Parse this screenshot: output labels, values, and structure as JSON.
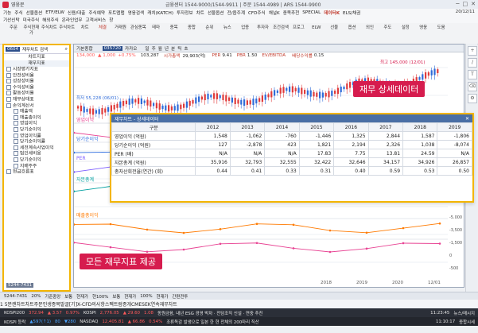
{
  "window": {
    "app_title": "영웅문",
    "center_info": "금융센터 1544-9000/1544-9911 | 주문 1544-4989 | ARS 1544-9900",
    "controls": [
      "─",
      "□",
      "✕"
    ]
  },
  "menu": {
    "items": [
      "기능",
      "주식",
      "선물옵션",
      "ETF/ELW",
      "신용/대출",
      "주식예약",
      "포트맵맵",
      "영웅검색",
      "캐치(KATCH)",
      "투자정보",
      "차트",
      "선물옵션",
      "전/옵주계",
      "CFD주식",
      "채널K",
      "종목추천",
      "SPECIAL",
      "데이터K",
      "ELS/채권"
    ],
    "highlight_index": 17,
    "items2": [
      "기산신탁",
      "미국주식",
      "해외주식",
      "온라인업무",
      "고객서비스",
      "창"
    ],
    "timestamp": "20/12/11",
    "time": "10:11:17"
  },
  "toolbar": {
    "buttons": [
      "주문",
      "주식현재가",
      "주식차트",
      "주식차트",
      "차트",
      "체결",
      "거래원",
      "관심종목",
      "테마",
      "종목",
      "종합",
      "순위",
      "뉴스",
      "업종",
      "투자자",
      "조건검색",
      "프로그",
      "ELW",
      "선물",
      "옵션",
      "외인",
      "주도",
      "설정",
      "영웅",
      "도움"
    ],
    "highlight_index": 5
  },
  "left_panel": {
    "code": "0604",
    "search_label": "재무차트 검색",
    "title": "차트지표",
    "section": "재무지표",
    "items": [
      "시장평가지표",
      "안전성비율",
      "성장성비율",
      "수익성비율",
      "활동성비율",
      "재무상태표",
      "손익계산서",
      "매출액",
      "매출총이익",
      "영업이익",
      "당기순이익",
      "영업이익률",
      "당기순이익률",
      "세전계속사업이익",
      "법인세비용",
      "당기순이익",
      "지배주주"
    ],
    "footer_items": [
      "현금흐름표"
    ],
    "bottom_code": "5244-7431"
  },
  "chart": {
    "tab_label": "기본종합",
    "code_label": "035720",
    "name_label": "카카오",
    "controls": [
      "일",
      "주",
      "월",
      "년",
      "분",
      "틱",
      "초"
    ],
    "quote": {
      "price": "134,000",
      "change": "▲ 1,000",
      "change_pct": "+0.75%",
      "volume": "103,287",
      "value_label": "시가총액",
      "value": "29,903(억)",
      "per_label": "PER",
      "per": "9.41",
      "pbr_label": "PBR",
      "pbr": "1.50",
      "ev_label": "EV/EBITDA",
      "div_label": "배당수익률",
      "div": "0.15"
    },
    "high_label": "최고 145,000 (12/01)",
    "low_label": "최저 55,228 (06/01)",
    "series_labels": [
      "영업이익",
      "당기순이익",
      "PER",
      "자본총계",
      "매출총이익"
    ],
    "axis_dates": [
      "2018",
      "2019",
      "2020",
      "12/01"
    ],
    "right_ticks": [
      "-5.000",
      "-3,500",
      "-1,500",
      "0",
      "-500"
    ]
  },
  "callouts": {
    "top": "재무 상세데이터",
    "bottom": "모든 재무지표 제공"
  },
  "overlay": {
    "title": "재무차트 - 상세데이터",
    "header_label": "구분",
    "years": [
      "2012",
      "2013",
      "2014",
      "2015",
      "2016",
      "2017",
      "2018",
      "2019"
    ],
    "rows": [
      {
        "label": "영업이익 (억원)",
        "values": [
          "1,548",
          "-1,062",
          "-760",
          "-1,446",
          "1,325",
          "2,844",
          "1,587",
          "-1,806"
        ]
      },
      {
        "label": "당기순이익 (억원)",
        "values": [
          "127",
          "-2,878",
          "423",
          "1,821",
          "2,194",
          "2,326",
          "1,038",
          "-8,074"
        ]
      },
      {
        "label": "PER (배)",
        "values": [
          "N/A",
          "N/A",
          "N/A",
          "17.83",
          "7.75",
          "13.81",
          "24.59",
          "N/A"
        ]
      },
      {
        "label": "자본총계 (억원)",
        "values": [
          "35,916",
          "32,793",
          "32,555",
          "32,422",
          "32,646",
          "34,157",
          "34,926",
          "26,857"
        ]
      },
      {
        "label": "총자산회전율(연간) (회)",
        "values": [
          "0.44",
          "0.41",
          "0.33",
          "0.31",
          "0.40",
          "0.59",
          "0.53",
          "0.50"
        ]
      }
    ]
  },
  "bottom_bar": {
    "left_controls": [
      "5244-7431",
      "20%",
      "기준중앙",
      "보통",
      "현재가",
      "현100%",
      "보통",
      "현재가",
      "100%",
      "현재가",
      "간편전투"
    ],
    "tabs": [
      "1 5분캔차트",
      "차트주문",
      "인생종목발굴[기]",
      "X-CFD의사항",
      "스펙트럼종개",
      "CMESEK연속",
      "재무차트"
    ],
    "tab2": "카운조회",
    "tab2b": "TIGER 200선물"
  },
  "status": {
    "line1": [
      {
        "label": "KOSPI200",
        "val": "372.94",
        "chg": "▲ 3.57",
        "pct": "0.97%",
        "cls": "up"
      },
      {
        "label": "KOSPI",
        "val": "2,776.05",
        "chg": "▲ 29.60",
        "pct": "1.08",
        "cls": "up"
      }
    ],
    "line1_news": "동원금융, 내년 ESG 경영 박차 · 전담조직 신설 · 연중 추진",
    "line1_time": "11:23:45",
    "line1_right": "뉴스/메시지",
    "line2": [
      {
        "label": "KOSPI 등락",
        "val": "▲597(↑1)",
        "chg": "80",
        "pct": "▼280",
        "cls": "dn"
      },
      {
        "label": "NASDAQ",
        "val": "12,405.81",
        "chg": "▲ 66.86",
        "pct": "0.54%",
        "cls": "up"
      }
    ],
    "line2_news": "조류독감 발생으로 일본 한 현 전체의 200마리 직산",
    "line2_time": "11:10:17",
    "line2_right": "종합시세"
  },
  "colors": {
    "accent": "#f3b500",
    "callout": "#d61c4e",
    "candle_up": "#e03b3b",
    "candle_down": "#2f6bd8",
    "series": [
      "#e84393",
      "#2d6cdf",
      "#7c5cff",
      "#00a0a0",
      "#ff7a00"
    ]
  }
}
